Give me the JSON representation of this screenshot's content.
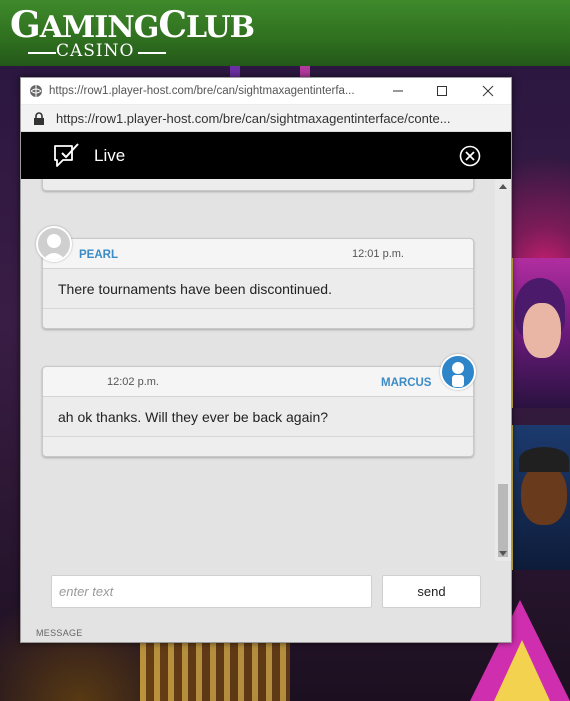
{
  "site": {
    "logo_main_1": "G",
    "logo_main_2": "AMING",
    "logo_main_3": "C",
    "logo_main_4": "LUB",
    "logo_sub": "CASINO"
  },
  "popup": {
    "title": "https://row1.player-host.com/bre/can/sightmaxagentinterfa...",
    "url": "https://row1.player-host.com/bre/can/sightmaxagentinterface/conte...",
    "chat_title": "Live"
  },
  "messages": [
    {
      "sender": "PEARL",
      "time": "12:01 p.m.",
      "text": "There tournaments have been discontinued.",
      "side": "agent"
    },
    {
      "sender": "MARCUS",
      "time": "12:02 p.m.",
      "text": "ah ok thanks. Will they ever be back again?",
      "side": "user"
    }
  ],
  "composer": {
    "placeholder": "enter text",
    "value": "",
    "send_label": "send",
    "message_label": "MESSAGE"
  },
  "colors": {
    "header_green": "#2f6f1f",
    "chat_header": "#000000",
    "name_blue": "#3b8bc5",
    "user_avatar": "#2e86c9"
  }
}
